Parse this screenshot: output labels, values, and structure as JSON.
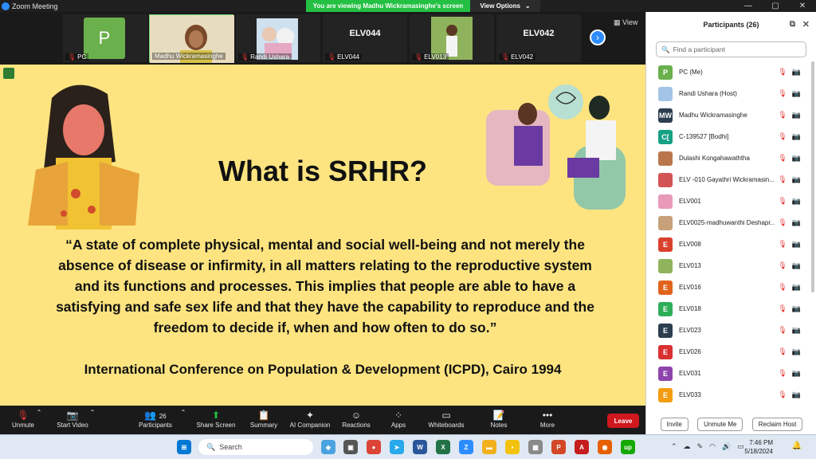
{
  "window": {
    "title": "Zoom Meeting",
    "banner": "You are viewing Madhu Wickramasinghe's screen",
    "view_options": "View Options",
    "min": "—",
    "max": "▢",
    "close": "✕"
  },
  "gallery": {
    "view_label": "View",
    "tiles": [
      {
        "name": "PC",
        "avatar": "P"
      },
      {
        "name": "Madhu Wickramasinghe"
      },
      {
        "name": "Randi Ushara"
      },
      {
        "name": "ELV044",
        "big": "ELV044"
      },
      {
        "name": "ELV013"
      },
      {
        "name": "ELV042",
        "big": "ELV042"
      }
    ]
  },
  "slide": {
    "title": "What is SRHR?",
    "quote": "“A state of complete physical, mental and social well-being and not merely the absence of disease or infirmity, in all matters relating to the reproductive system and its functions and processes. This implies that people are able to have a satisfying and safe sex life and that they have the capability to reproduce and the freedom to decide if, when and how often to do so.”",
    "citation": "International Conference on Population & Development (ICPD), Cairo 1994"
  },
  "participants": {
    "title": "Participants (26)",
    "search_placeholder": "Find a participant",
    "list": [
      {
        "name": "PC (Me)",
        "initial": "P",
        "color": "#6ab04c"
      },
      {
        "name": "Randi Ushara (Host)",
        "initial": "",
        "color": "#a3c4e6"
      },
      {
        "name": "Madhu Wickramasinghe",
        "initial": "MW",
        "color": "#2c3e50"
      },
      {
        "name": "C-139527 [Bodhi]",
        "initial": "C[",
        "color": "#16a085"
      },
      {
        "name": "Dulashi Kongahawaththa",
        "initial": "",
        "color": "#b9764a"
      },
      {
        "name": "ELV -010 Gayathri Wickramasin...",
        "initial": "",
        "color": "#d35454"
      },
      {
        "name": "ELV001",
        "initial": "",
        "color": "#e89ab8"
      },
      {
        "name": "ELV0025-madhuwanthi Deshapr...",
        "initial": "",
        "color": "#c7a17a"
      },
      {
        "name": "ELV008",
        "initial": "E",
        "color": "#d9412e"
      },
      {
        "name": "ELV013",
        "initial": "",
        "color": "#8fb35c"
      },
      {
        "name": "ELV016",
        "initial": "E",
        "color": "#e2641c"
      },
      {
        "name": "ELV018",
        "initial": "E",
        "color": "#2fae5a"
      },
      {
        "name": "ELV023",
        "initial": "E",
        "color": "#2c3e50"
      },
      {
        "name": "ELV026",
        "initial": "E",
        "color": "#d93030"
      },
      {
        "name": "ELV031",
        "initial": "E",
        "color": "#8e44ad"
      },
      {
        "name": "ELV033",
        "initial": "E",
        "color": "#f39c12"
      }
    ],
    "invite": "Invite",
    "unmute_me": "Unmute Me",
    "reclaim_host": "Reclaim Host"
  },
  "toolbar": {
    "unmute": "Unmute",
    "start_video": "Start Video",
    "participants": "Participants",
    "participants_count": "26",
    "share_screen": "Share Screen",
    "summary": "Summary",
    "ai_companion": "AI Companion",
    "reactions": "Reactions",
    "apps": "Apps",
    "whiteboards": "Whiteboards",
    "notes": "Notes",
    "more": "More",
    "leave": "Leave"
  },
  "taskbar": {
    "search": "Search",
    "time": "7:46 PM",
    "date": "5/18/2024"
  }
}
